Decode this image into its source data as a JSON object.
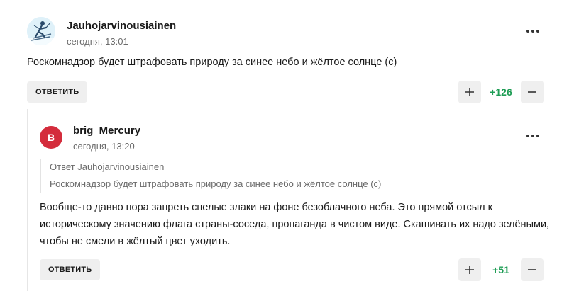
{
  "comments": [
    {
      "username": "Jauhojarvinousiainen",
      "time": "сегодня, 13:01",
      "text": "Роскомнадзор будет штрафовать природу за синее небо и жёлтое солнце (с)",
      "reply_label": "ОТВЕТИТЬ",
      "score": "+126",
      "avatar_icon": "skier-icon"
    },
    {
      "username": "brig_Mercury",
      "time": "сегодня, 13:20",
      "avatar_letter": "B",
      "quote": {
        "prefix": "Ответ",
        "author": "Jauhojarvinousiainen",
        "text": "Роскомнадзор будет штрафовать природу за синее небо и жёлтое солнце (с)"
      },
      "text_lines": [
        "Вообще-то давно пора запреть спелые злаки на фоне безоблачного неба. Это прямой отсыл к",
        "историческому значению флага страны-соседа, пропаганда в чистом виде. Скашивать их надо зелёными,",
        "чтобы не смели в жёлтый цвет уходить."
      ],
      "reply_label": "ОТВЕТИТЬ",
      "score": "+51"
    }
  ],
  "colors": {
    "score_green": "#1f9d55",
    "avatar_red": "#d42c3c",
    "button_bg": "#efefef"
  }
}
